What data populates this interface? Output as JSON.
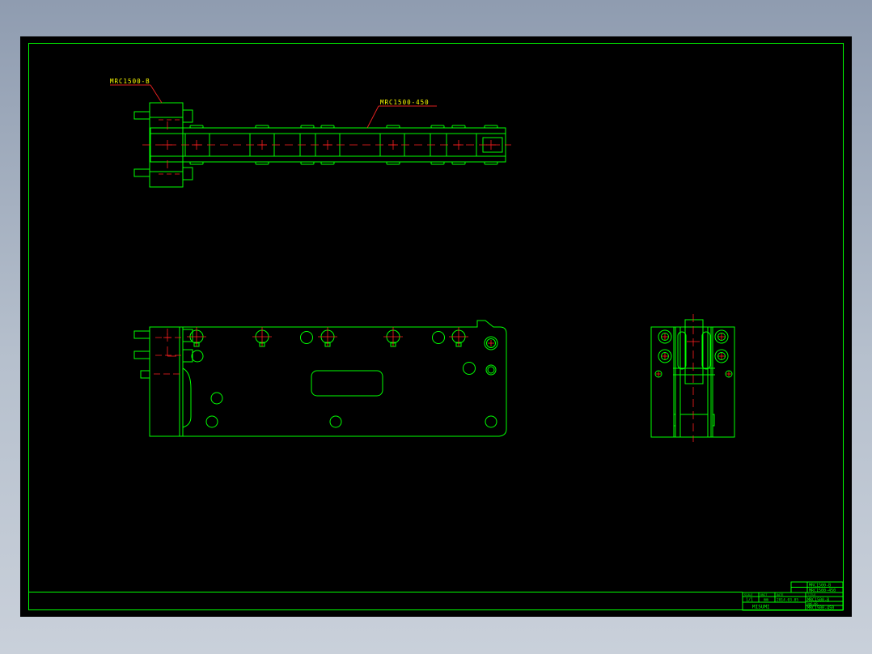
{
  "drawing": {
    "colors": {
      "geometry": "#00ff00",
      "centerline": "#ff2020",
      "leader": "#e02020",
      "label": "#ffff00",
      "title_text": "#00ff00",
      "background": "#000000"
    },
    "labels": {
      "part_bracket": "MRC1500-B",
      "part_rail": "MRC1500-450"
    },
    "title_block": {
      "upper_title": "MRC1500-B",
      "upper_code": "MRC1500-450",
      "scale": "1/1",
      "units": "mm",
      "date": "2014.03.05",
      "part_no": "MRC1500-B",
      "company": "MISUMI",
      "drawing_no": "MRC1500-450",
      "header_scale": "SCALE",
      "header_unit": "UNIT",
      "header_date": "DATE",
      "header_title": "TITLE",
      "header_dwg": "DWG.NO"
    }
  }
}
